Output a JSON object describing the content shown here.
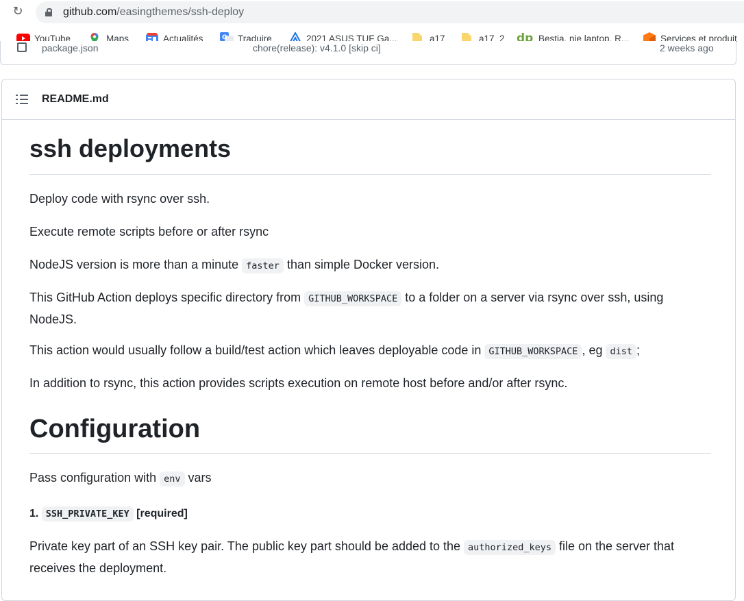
{
  "browser": {
    "url_domain": "github.com",
    "url_path": "/easingthemes/ssh-deploy",
    "bookmarks": [
      {
        "label": "YouTube",
        "icon": "youtube-icon"
      },
      {
        "label": "Maps",
        "icon": "maps-icon"
      },
      {
        "label": "Actualités",
        "icon": "news-icon"
      },
      {
        "label": "Traduire",
        "icon": "translate-icon"
      },
      {
        "label": "2021 ASUS TUF Ga...",
        "icon": "asus-icon"
      },
      {
        "label": "a17",
        "icon": "folder-icon"
      },
      {
        "label": "a17_2",
        "icon": "folder-icon"
      },
      {
        "label": "Bestia, nie laptop. R...",
        "icon": "dp-icon"
      },
      {
        "label": "Services et produit",
        "icon": "cube-icon"
      }
    ]
  },
  "file_row": {
    "name": "package.json",
    "message": "chore(release): v4.1.0 [skip ci]",
    "age": "2 weeks ago"
  },
  "readme": {
    "filename": "README.md",
    "h1": "ssh deployments",
    "p1": "Deploy code with rsync over ssh.",
    "p2": "Execute remote scripts before or after rsync",
    "p3": {
      "pre": "NodeJS version is more than a minute ",
      "code": "faster",
      "post": " than simple Docker version."
    },
    "p4": {
      "pre": "This GitHub Action deploys specific directory from ",
      "code": "GITHUB_WORKSPACE",
      "post": " to a folder on a server via rsync over ssh, using NodeJS."
    },
    "p5": {
      "pre": "This action would usually follow a build/test action which leaves deployable code in ",
      "code1": "GITHUB_WORKSPACE",
      "mid": ", eg ",
      "code2": "dist",
      "post": ";"
    },
    "p6": "In addition to rsync, this action provides scripts execution on remote host before and/or after rsync.",
    "h2": "Configuration",
    "p7": {
      "pre": "Pass configuration with ",
      "code": "env",
      "post": " vars"
    },
    "item1": {
      "num": "1. ",
      "code": "SSH_PRIVATE_KEY",
      "post": " [required]"
    },
    "p8": {
      "pre": "Private key part of an SSH key pair. The public key part should be added to the ",
      "code": "authorized_keys",
      "post": " file on the server that receives the deployment."
    }
  },
  "colors": {
    "text": "#1f2328",
    "border": "#d0d7de",
    "code_bg": "#eff1f3"
  }
}
